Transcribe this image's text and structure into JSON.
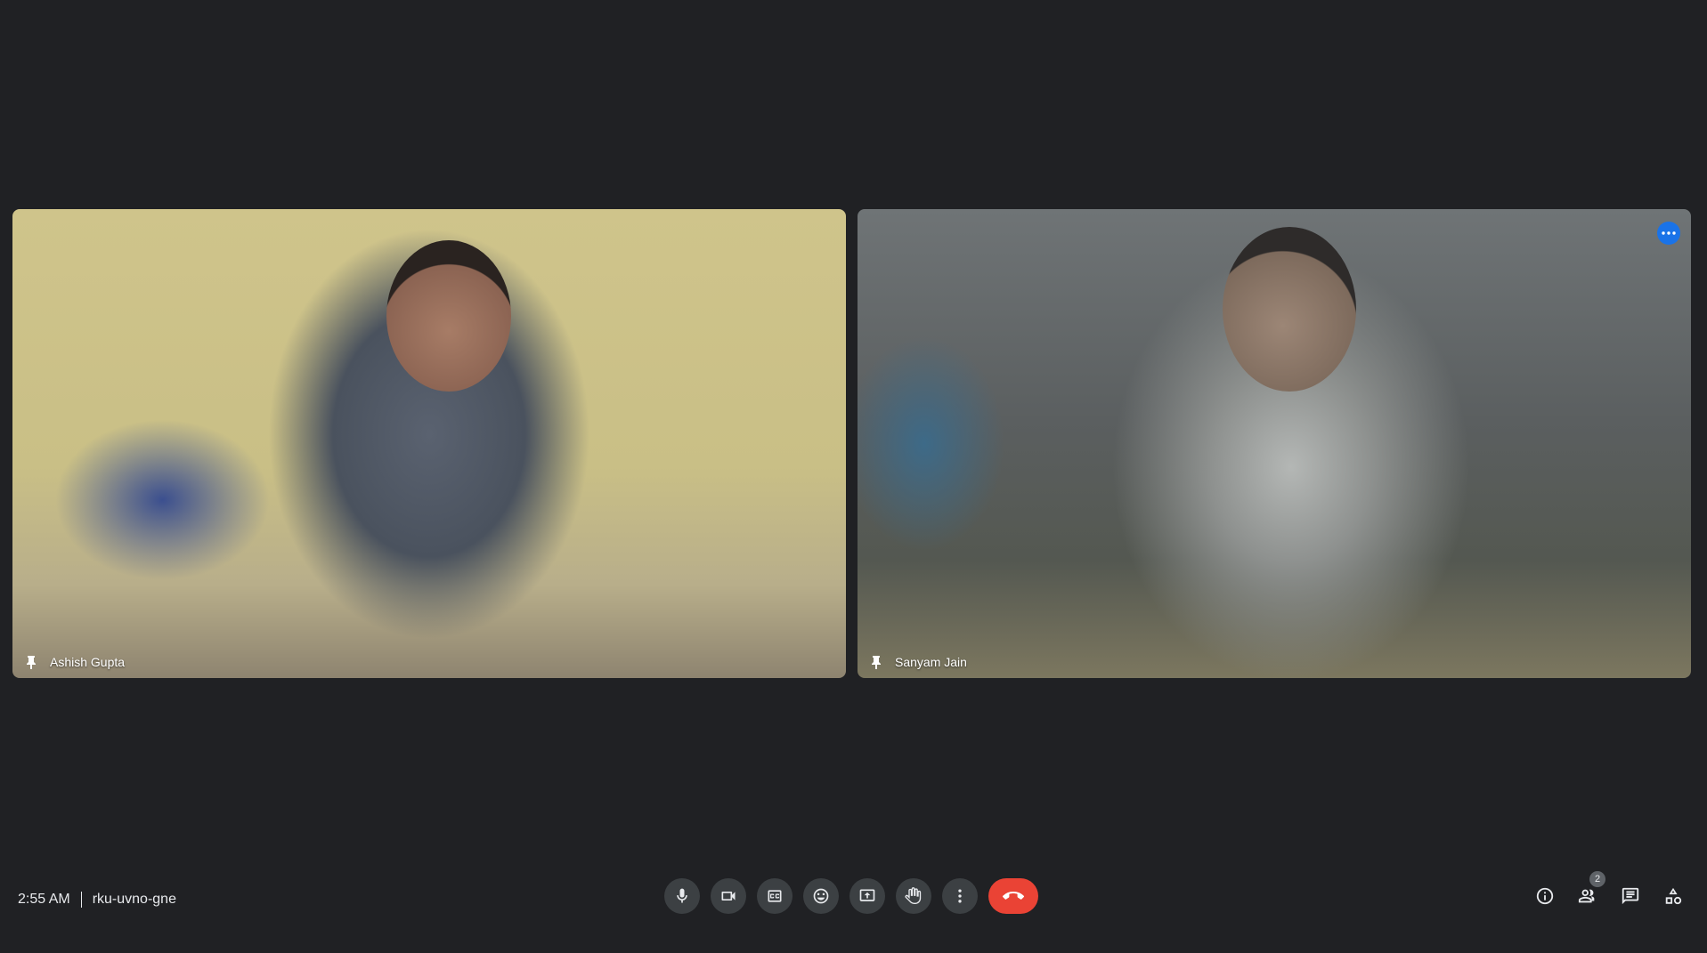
{
  "participants": [
    {
      "name": "Ashish Gupta"
    },
    {
      "name": "Sanyam Jain"
    }
  ],
  "meeting": {
    "time": "2:55 AM",
    "code": "rku-uvno-gne"
  },
  "people_count": "2",
  "controls": [
    {
      "icon": "microphone-icon"
    },
    {
      "icon": "camera-icon"
    },
    {
      "icon": "captions-icon"
    },
    {
      "icon": "emoji-icon"
    },
    {
      "icon": "present-screen-icon"
    },
    {
      "icon": "raise-hand-icon"
    },
    {
      "icon": "more-options-icon"
    },
    {
      "icon": "end-call-icon"
    }
  ],
  "colors": {
    "background": "#202124",
    "control_bg": "#3c4043",
    "end_call": "#ea4335",
    "accent": "#1a73e8"
  }
}
